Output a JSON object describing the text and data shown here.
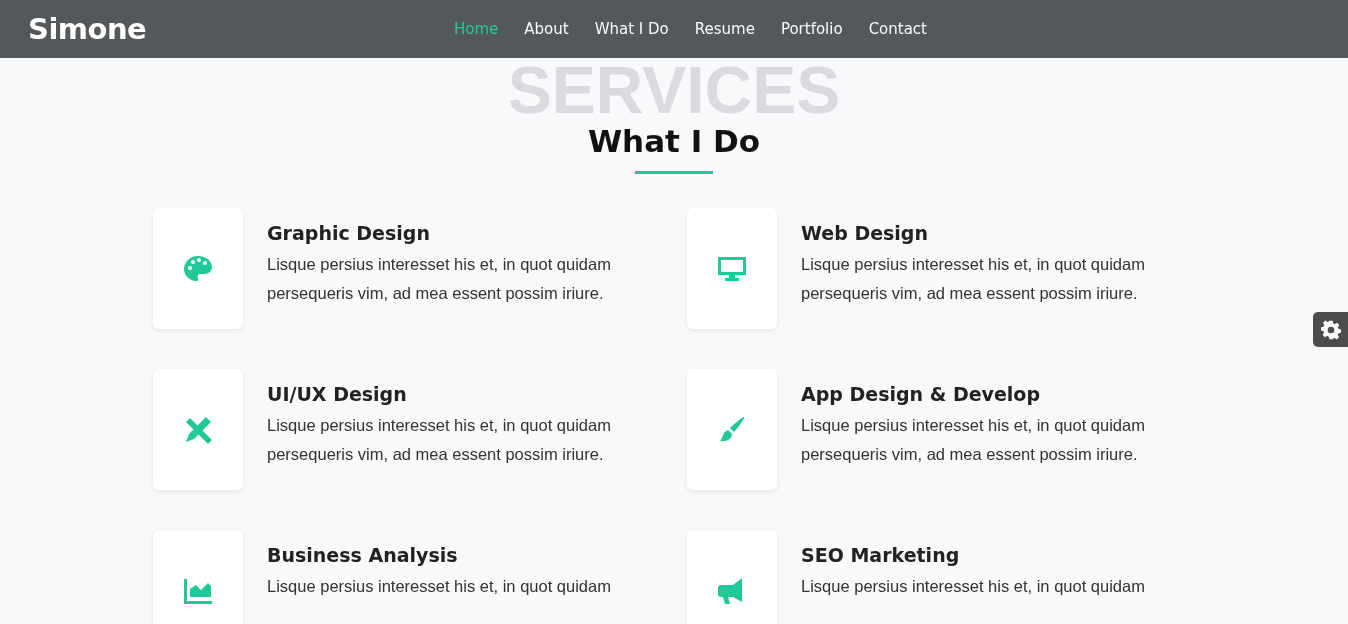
{
  "brand": "Simone",
  "nav": [
    {
      "label": "Home",
      "selected": true
    },
    {
      "label": "About",
      "selected": false
    },
    {
      "label": "What I Do",
      "selected": false
    },
    {
      "label": "Resume",
      "selected": false
    },
    {
      "label": "Portfolio",
      "selected": false
    },
    {
      "label": "Contact",
      "selected": false
    }
  ],
  "section": {
    "backdrop": "SERVICES",
    "title": "What I Do"
  },
  "services": [
    {
      "title": "Graphic Design",
      "description": "Lisque persius interesset his et, in quot quidam persequeris vim, ad mea essent possim iriure."
    },
    {
      "title": "Web Design",
      "description": "Lisque persius interesset his et, in quot quidam persequeris vim, ad mea essent possim iriure."
    },
    {
      "title": "UI/UX Design",
      "description": "Lisque persius interesset his et, in quot quidam persequeris vim, ad mea essent possim iriure."
    },
    {
      "title": "App Design & Develop",
      "description": "Lisque persius interesset his et, in quot quidam persequeris vim, ad mea essent possim iriure."
    },
    {
      "title": "Business Analysis",
      "description": "Lisque persius interesset his et, in quot quidam"
    },
    {
      "title": "SEO Marketing",
      "description": "Lisque persius interesset his et, in quot quidam"
    }
  ]
}
